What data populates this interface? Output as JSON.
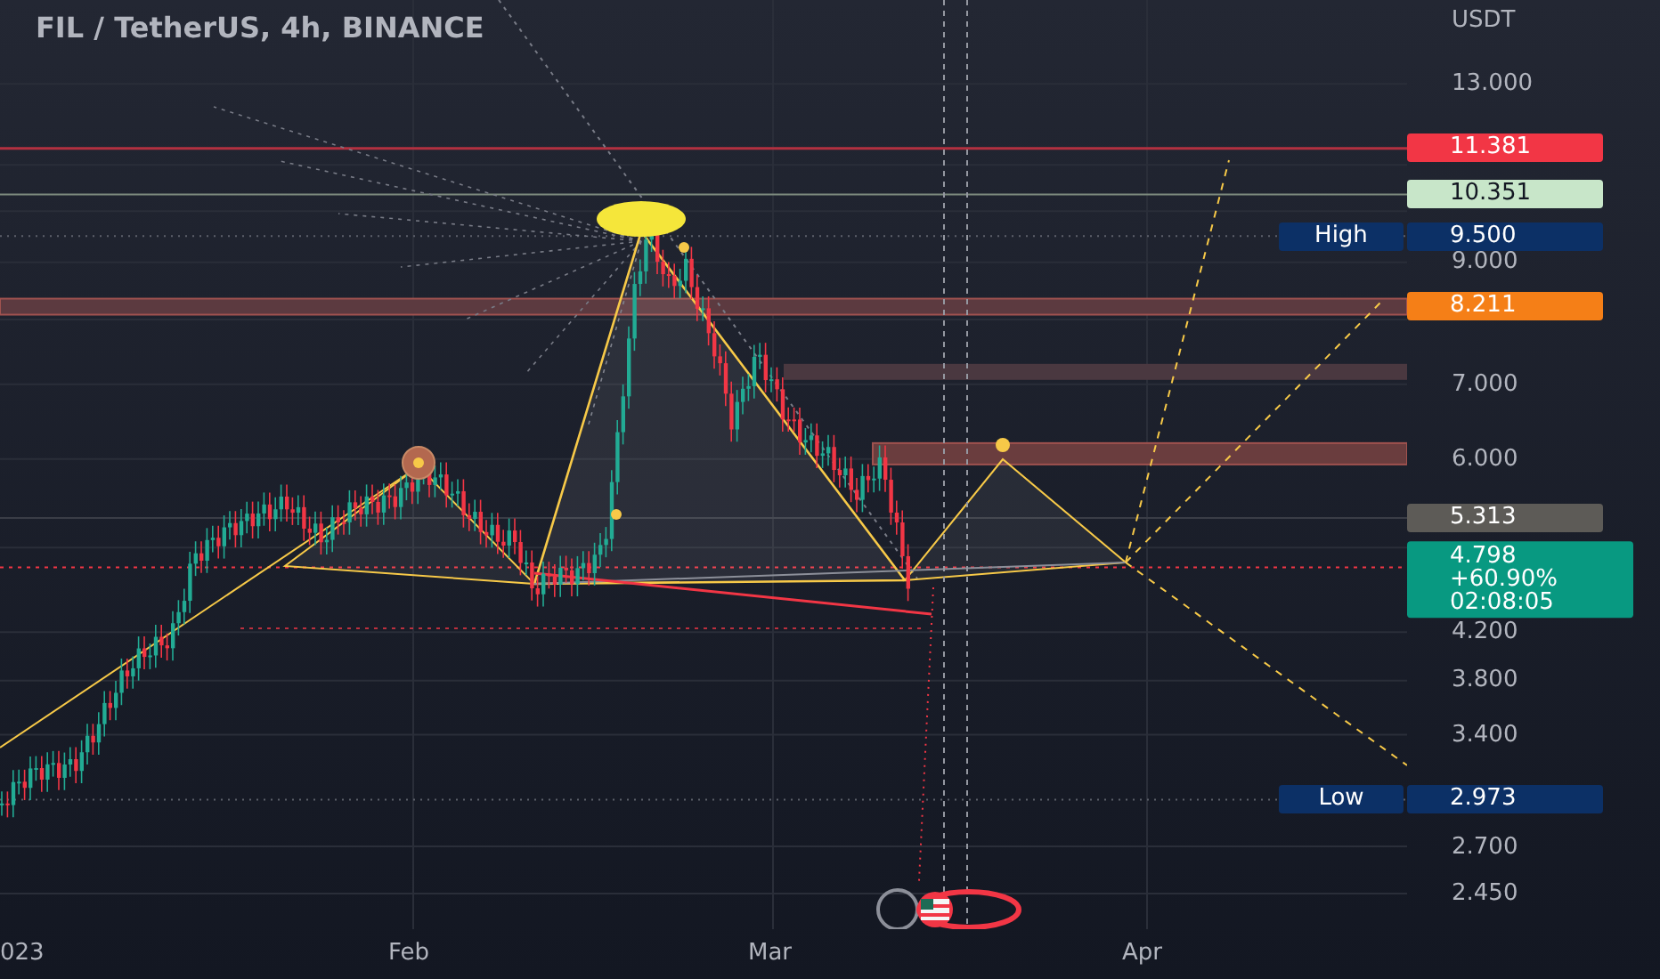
{
  "title": "FIL / TetherUS, 4h, BINANCE",
  "currency": "USDT",
  "price_ticks": [
    "13.000",
    "9.000",
    "7.000",
    "6.000",
    "4.200",
    "3.800",
    "3.400",
    "2.700",
    "2.450"
  ],
  "price_tags": [
    {
      "kind": "plain",
      "value": "11.381",
      "color": "#f23645"
    },
    {
      "kind": "plain",
      "value": "10.351",
      "color": "#c8e6c9"
    },
    {
      "kind": "labeled",
      "label": "High",
      "value": "9.500",
      "color": "#0c3066"
    },
    {
      "kind": "plain",
      "value": "8.211",
      "color": "#f57f17"
    },
    {
      "kind": "plain",
      "value": "5.313",
      "color": "#5d5b57"
    },
    {
      "kind": "last",
      "value": "4.798",
      "change": "+60.90%",
      "countdown": "02:08:05",
      "color": "#089981"
    },
    {
      "kind": "labeled",
      "label": "Low",
      "value": "2.973",
      "color": "#0c3066"
    }
  ],
  "time_labels": [
    "023",
    "Feb",
    "Mar",
    "Apr"
  ]
}
